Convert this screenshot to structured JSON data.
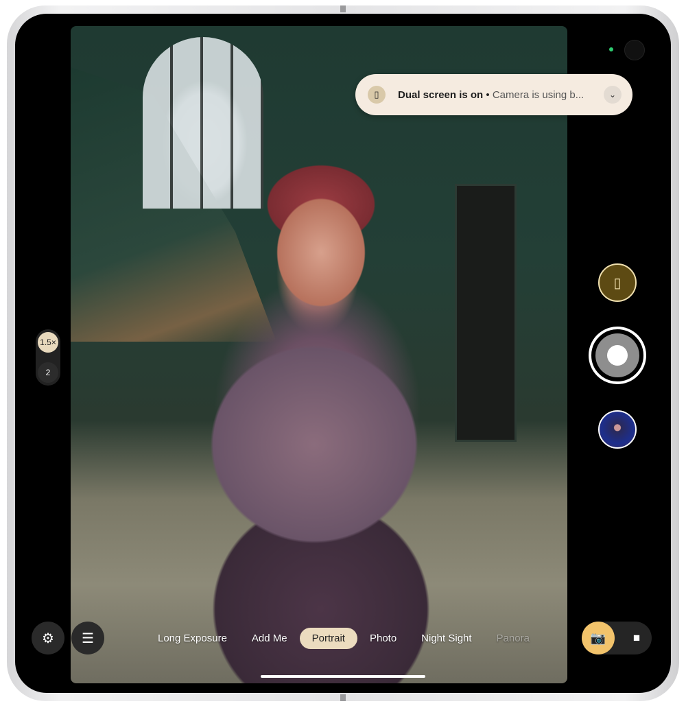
{
  "notification": {
    "title": "Dual screen is on",
    "separator": "•",
    "subtitle": "Camera is using b...",
    "icon": "dual-screen-icon",
    "expand_icon": "chevron-down-icon"
  },
  "zoom": {
    "levels": [
      "1.5×",
      "2"
    ],
    "selected": "1.5×"
  },
  "right_controls": {
    "dual_screen_icon": "dual-screen-icon",
    "shutter": "shutter-button",
    "thumbnail": "last-photo-thumbnail"
  },
  "bottom": {
    "settings_icon": "settings-icon",
    "adjust_icon": "sliders-icon",
    "modes": [
      "Long Exposure",
      "Add Me",
      "Portrait",
      "Photo",
      "Night Sight",
      "Panora"
    ],
    "active_mode": "Portrait",
    "photo_icon": "camera-icon",
    "video_icon": "video-icon"
  },
  "colors": {
    "accent": "#f2c36b",
    "active_mode_bg": "#ecdcbf",
    "notification_bg": "#f5ebe0",
    "dual_btn": "#5d4a13"
  }
}
